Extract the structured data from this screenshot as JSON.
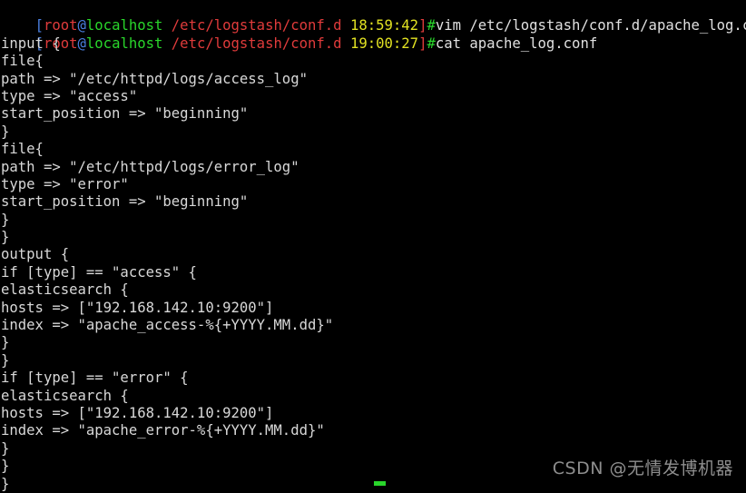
{
  "terminal": {
    "background_color": "#000000",
    "foreground_color": "#d8d8d8",
    "prompt_colors": {
      "bracket": "#4a7fe0",
      "user": "#e03b3b",
      "at": "#4a7fe0",
      "host": "#29d62b",
      "path": "#e03b3b",
      "time": "#e2e222",
      "hash": "#29d62b",
      "command": "#e0e0e0"
    },
    "prompts": [
      {
        "bracket_open": "[",
        "user": "root",
        "at": "@",
        "host": "localhost",
        "space1": " ",
        "path": "/etc/logstash/conf.d",
        "space2": " ",
        "time": "18:59:42",
        "bracket_close": "]",
        "hash": "#",
        "command": "vim /etc/logstash/conf.d/apache_log.conf"
      },
      {
        "bracket_open": "[",
        "user": "root",
        "at": "@",
        "host": "localhost",
        "space1": " ",
        "path": "/etc/logstash/conf.d",
        "space2": " ",
        "time": "19:00:27",
        "bracket_close": "]",
        "hash": "#",
        "command": "cat apache_log.conf"
      }
    ],
    "output_lines": [
      "input {",
      "file{",
      "path => \"/etc/httpd/logs/access_log\"",
      "type => \"access\"",
      "start_position => \"beginning\"",
      "}",
      "file{",
      "path => \"/etc/httpd/logs/error_log\"",
      "type => \"error\"",
      "start_position => \"beginning\"",
      "}",
      "}",
      "output {",
      "if [type] == \"access\" {",
      "elasticsearch {",
      "hosts => [\"192.168.142.10:9200\"]",
      "index => \"apache_access-%{+YYYY.MM.dd}\"",
      "}",
      "}",
      "if [type] == \"error\" {",
      "elasticsearch {",
      "hosts => [\"192.168.142.10:9200\"]",
      "index => \"apache_error-%{+YYYY.MM.dd}\"",
      "}",
      "}",
      "}"
    ],
    "cursor": {
      "visible": true,
      "color": "#29d62b"
    }
  },
  "watermark": {
    "text": "CSDN @无情发博机器",
    "color": "#9b9b9b"
  }
}
